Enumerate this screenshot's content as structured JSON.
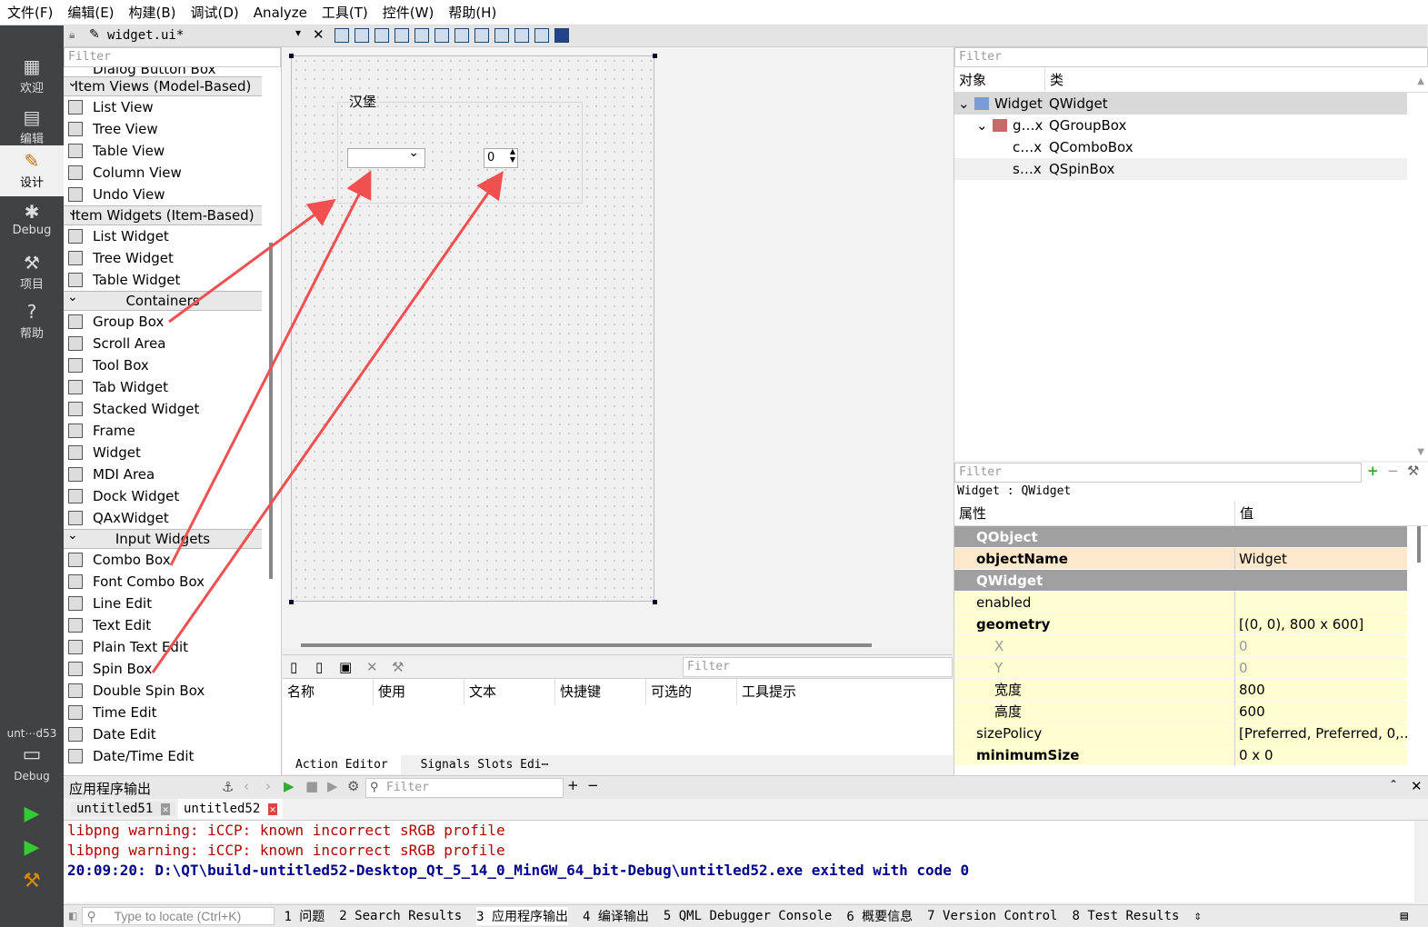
{
  "menu": [
    "文件(F)",
    "编辑(E)",
    "构建(B)",
    "调试(D)",
    "Analyze",
    "工具(T)",
    "控件(W)",
    "帮助(H)"
  ],
  "modes": [
    "欢迎",
    "编辑",
    "设计",
    "Debug",
    "项目",
    "帮助"
  ],
  "mode_bottom": {
    "project": "unt⋯d53",
    "label": "Debug"
  },
  "editor": {
    "filename": "widget.ui*"
  },
  "widgetbox": {
    "filter": "Filter",
    "clipped": "Dialog Button Box",
    "categories": [
      {
        "label": "Item Views (Model-Based)",
        "items": [
          "List View",
          "Tree View",
          "Table View",
          "Column View",
          "Undo View"
        ]
      },
      {
        "label": "Item Widgets (Item-Based)",
        "items": [
          "List Widget",
          "Tree Widget",
          "Table Widget"
        ]
      },
      {
        "label": "Containers",
        "items": [
          "Group Box",
          "Scroll Area",
          "Tool Box",
          "Tab Widget",
          "Stacked Widget",
          "Frame",
          "Widget",
          "MDI Area",
          "Dock Widget",
          "QAxWidget"
        ]
      },
      {
        "label": "Input Widgets",
        "items": [
          "Combo Box",
          "Font Combo Box",
          "Line Edit",
          "Text Edit",
          "Plain Text Edit",
          "Spin Box",
          "Double Spin Box",
          "Time Edit",
          "Date Edit",
          "Date/Time Edit"
        ]
      }
    ]
  },
  "form": {
    "groupbox_title": "汉堡",
    "spin_value": "0"
  },
  "action_editor": {
    "filter": "Filter",
    "headers": [
      "名称",
      "使用",
      "文本",
      "快捷键",
      "可选的",
      "工具提示"
    ],
    "tabs": [
      "Action Editor",
      "Signals  Slots Edi⋯"
    ]
  },
  "object_inspector": {
    "filter": "Filter",
    "headers": [
      "对象",
      "类"
    ],
    "rows": [
      [
        "Widget",
        "QWidget"
      ],
      [
        "g…x",
        "QGroupBox"
      ],
      [
        "c…x",
        "QComboBox"
      ],
      [
        "s…x",
        "QSpinBox"
      ]
    ]
  },
  "property_editor": {
    "filter": "Filter",
    "context": "Widget : QWidget",
    "headers": [
      "属性",
      "值"
    ],
    "rows": [
      {
        "k": "QObject",
        "v": "",
        "type": "grp"
      },
      {
        "k": "objectName",
        "v": "Widget",
        "type": "or"
      },
      {
        "k": "QWidget",
        "v": "",
        "type": "grp"
      },
      {
        "k": "enabled",
        "v": "",
        "type": "yel"
      },
      {
        "k": "geometry",
        "v": "[(0, 0), 800 x 600]",
        "type": "yel"
      },
      {
        "k": "X",
        "v": "0",
        "type": "yel"
      },
      {
        "k": "Y",
        "v": "0",
        "type": "yel"
      },
      {
        "k": "宽度",
        "v": "800",
        "type": "yel"
      },
      {
        "k": "高度",
        "v": "600",
        "type": "yel"
      },
      {
        "k": "sizePolicy",
        "v": "[Preferred, Preferred, 0,...",
        "type": "yel"
      },
      {
        "k": "minimumSize",
        "v": "0 x 0",
        "type": "yel"
      }
    ]
  },
  "output": {
    "title": "应用程序输出",
    "filter": "Filter",
    "tabs": [
      "untitled51",
      "untitled52"
    ],
    "lines": [
      "libpng warning: iCCP: known incorrect sRGB profile",
      "libpng warning: iCCP: known incorrect sRGB profile"
    ],
    "exit_line": "20:09:20: D:\\QT\\build-untitled52-Desktop_Qt_5_14_0_MinGW_64_bit-Debug\\untitled52.exe exited with code 0"
  },
  "statusbar": {
    "locate": "Type to locate (Ctrl+K)",
    "items": [
      "1 问题",
      "2 Search Results",
      "3 应用程序输出",
      "4 编译输出",
      "5 QML Debugger Console",
      "6 概要信息",
      "7 Version Control",
      "8 Test Results"
    ]
  }
}
